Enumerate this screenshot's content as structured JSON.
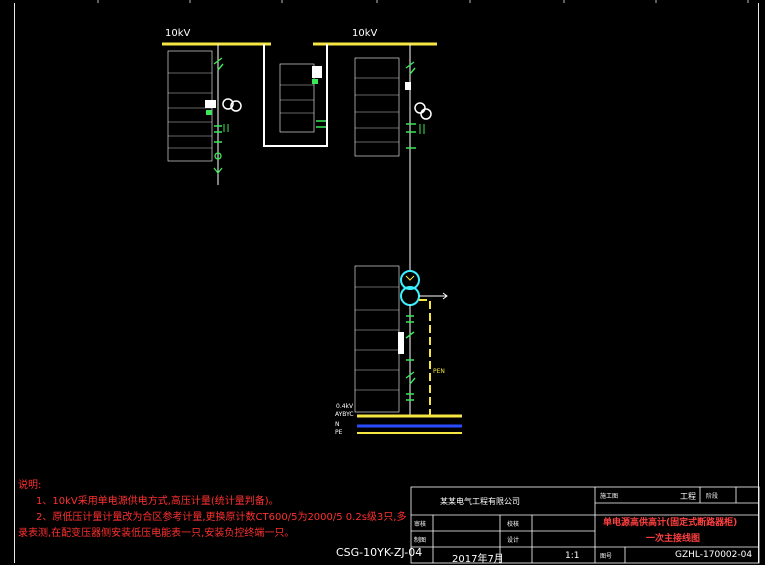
{
  "colors": {
    "background": "#000000",
    "bus": "#f5e642",
    "equipment_green": "#3ce85a",
    "wire_white": "#ffffff",
    "transformer_cyan": "#3cf0ff",
    "notes_red": "#ff3030",
    "neutral_blue": "#2a4cff"
  },
  "bus": {
    "left_label": "10kV",
    "right_label": "10kV",
    "lv_label": "0.4kV",
    "pen_label": "PEN"
  },
  "lv_lines": [
    "AYBYC",
    "N",
    "PE"
  ],
  "notes": {
    "title": "说明:",
    "line1": "1、10kV采用单电源供电方式,高压计量(统计量判备)。",
    "line2": "2、原低压计量计量改为合区参考计量,更换原计数CT600/5为2000/5 0.2s级3只,多",
    "line3": "录表测,在配变压器侧安装低压电能表一只,安装负控终端一只。"
  },
  "drawing_code": "CSG-10YK-ZJ-04",
  "title_block": {
    "company": "某某电气工程有限公司",
    "project_label": "工程",
    "stage_label": "阶段",
    "stage_value": "施工图",
    "check_label": "校核",
    "design_label": "设计",
    "review_label": "审核",
    "draw_label": "制图",
    "date": "2017年7月",
    "scale": "1:1",
    "drawing_no_label": "图号",
    "title_line1": "单电源高供高计(固定式断路器柜)",
    "title_line2": "一次主接线图",
    "drawing_no": "GZHL-170002-04"
  }
}
